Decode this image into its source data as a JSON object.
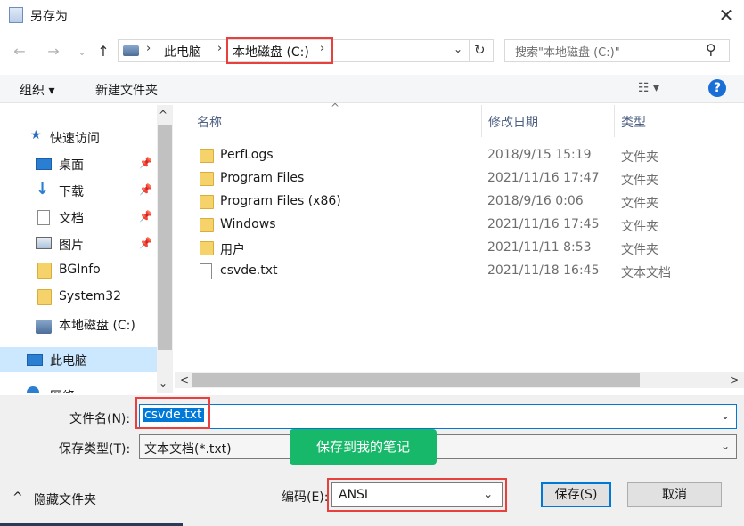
{
  "window": {
    "title": "另存为",
    "close_glyph": "✕"
  },
  "nav_buttons": {
    "back": "←",
    "forward": "→",
    "recent": "⌄",
    "up": "↑"
  },
  "address": {
    "sep": "›",
    "crumbs": [
      "此电脑",
      "本地磁盘 (C:)"
    ],
    "dropdown_glyph": "⌄",
    "refresh_glyph": "↻"
  },
  "search": {
    "placeholder": "搜索\"本地磁盘 (C:)\"",
    "icon_glyph": "⚲"
  },
  "toolbar": {
    "organize": "组织 ▾",
    "new_folder": "新建文件夹",
    "view_glyph": "☷ ▾",
    "help_glyph": "?"
  },
  "nav_pane": {
    "quick_access": "快速访问",
    "items": [
      {
        "label": "桌面",
        "pinned": "📌"
      },
      {
        "label": "下载",
        "pinned": "📌"
      },
      {
        "label": "文档",
        "pinned": "📌"
      },
      {
        "label": "图片",
        "pinned": "📌"
      },
      {
        "label": "BGInfo"
      },
      {
        "label": "System32"
      },
      {
        "label": "本地磁盘 (C:)"
      },
      {
        "label": "此电脑"
      },
      {
        "label": "网络"
      }
    ]
  },
  "file_list": {
    "columns": {
      "name": "名称",
      "date": "修改日期",
      "type": "类型"
    },
    "sort_glyph": "^",
    "rows": [
      {
        "name": "PerfLogs",
        "date": "2018/9/15 15:19",
        "type": "文件夹",
        "kind": "folder"
      },
      {
        "name": "Program Files",
        "date": "2021/11/16 17:47",
        "type": "文件夹",
        "kind": "folder"
      },
      {
        "name": "Program Files (x86)",
        "date": "2018/9/16 0:06",
        "type": "文件夹",
        "kind": "folder"
      },
      {
        "name": "Windows",
        "date": "2021/11/16 17:45",
        "type": "文件夹",
        "kind": "folder"
      },
      {
        "name": "用户",
        "date": "2021/11/11 8:53",
        "type": "文件夹",
        "kind": "folder"
      },
      {
        "name": "csvde.txt",
        "date": "2021/11/18 16:45",
        "type": "文本文档",
        "kind": "text"
      }
    ]
  },
  "scroll": {
    "left": "<",
    "right": ">",
    "up": "^",
    "down": "⌄"
  },
  "save_form": {
    "filename_label": "文件名(N):",
    "filename_value": "csvde.txt",
    "filetype_label": "保存类型(T):",
    "filetype_value": "文本文档(*.txt)",
    "encoding_label": "编码(E):",
    "encoding_value": "ANSI",
    "save_button": "保存(S)",
    "cancel_button": "取消",
    "hide_folders": "隐藏文件夹",
    "hide_glyph": "^"
  },
  "tooltip": {
    "text": "保存到我的笔记"
  },
  "colors": {
    "accent": "#0078d7",
    "highlight_red": "#e8403c",
    "tooltip_green": "#18b86a"
  }
}
